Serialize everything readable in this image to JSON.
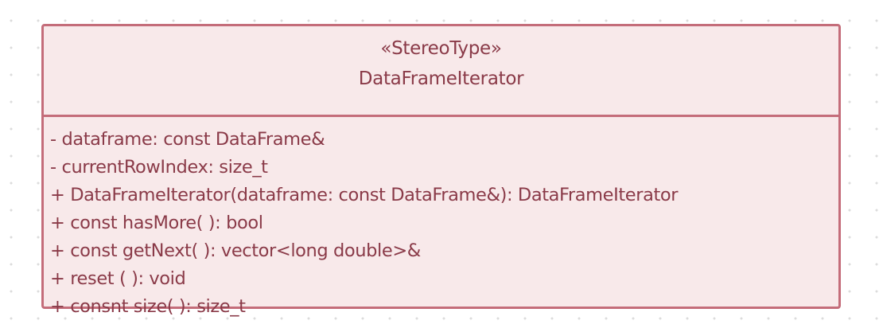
{
  "class": {
    "stereotype": "«StereoType»",
    "name": "DataFrameIterator",
    "members": [
      "- dataframe: const DataFrame&",
      "- currentRowIndex: size_t",
      "+ DataFrameIterator(dataframe: const DataFrame&): DataFrameIterator",
      "+ const hasMore( ): bool",
      "+ const getNext( ): vector<long double>&",
      "+ reset ( ): void",
      "+ consnt size( ): size_t"
    ]
  },
  "colors": {
    "box_fill": "#f8e9ea",
    "box_border": "#c46d7a",
    "text": "#8a3a48",
    "canvas_dots": "#dcdcdc"
  }
}
